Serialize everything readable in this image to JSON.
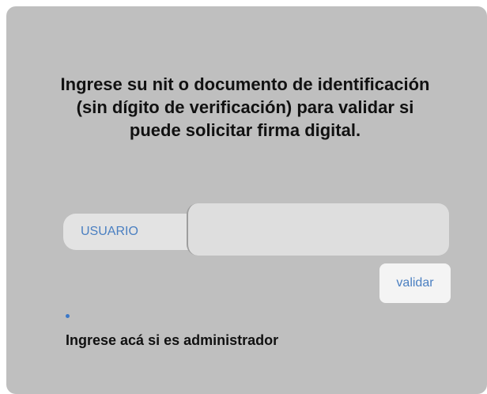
{
  "form": {
    "heading": "Ingrese su nit o documento de identificación (sin dígito de verificación) para validar si puede solicitar firma digital.",
    "user_label": "USUARIO",
    "user_value": "",
    "user_placeholder": "",
    "validate_label": "validar"
  },
  "footer": {
    "admin_link": "Ingrese acá si es administrador"
  },
  "colors": {
    "panel_background": "#bfbfbf",
    "accent": "#4a7fc1",
    "text": "#111111"
  }
}
